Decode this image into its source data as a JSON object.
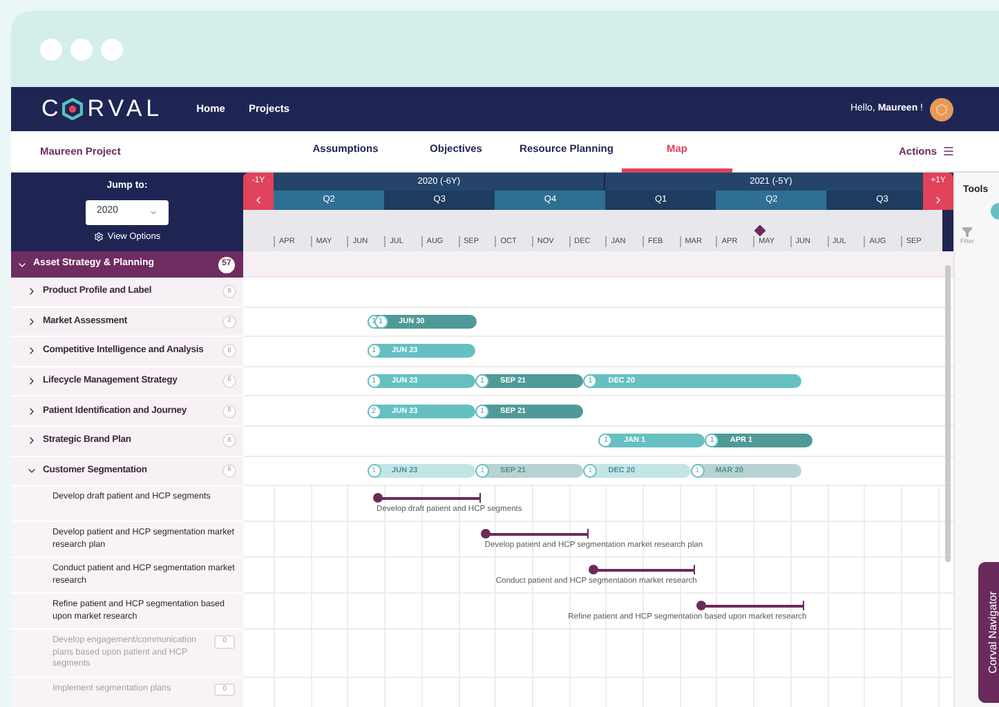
{
  "logo": {
    "left": "C",
    "right": "RVAL"
  },
  "nav": [
    "Home",
    "Projects"
  ],
  "greeting": "Hello, **Maureen** !",
  "project": "Maureen Project",
  "tabs": [
    {
      "label": "Assumptions",
      "selected": false
    },
    {
      "label": "Objectives",
      "selected": false
    },
    {
      "label": "Resource Planning",
      "selected": false
    },
    {
      "label": "Map",
      "selected": true
    }
  ],
  "actions": "Actions",
  "jump": {
    "label": "Jump to:",
    "value": "2020",
    "view_options": "View Options"
  },
  "timeline": {
    "prev_year": "-1Y",
    "next_year": "+1Y",
    "years": [
      {
        "label": "2020 (-6Y)",
        "quarters": [
          {
            "label": "Q2",
            "months": [
              "APR",
              "MAY",
              "JUN"
            ]
          },
          {
            "label": "Q3",
            "months": [
              "JUL",
              "AUG",
              "SEP"
            ]
          },
          {
            "label": "Q4",
            "months": [
              "OCT",
              "NOV",
              "DEC"
            ]
          }
        ]
      },
      {
        "label": "2021 (-5Y)",
        "quarters": [
          {
            "label": "Q1",
            "months": [
              "JAN",
              "FEB",
              "MAR"
            ]
          },
          {
            "label": "Q2",
            "months": [
              "APR",
              "MAY",
              "JUN"
            ]
          },
          {
            "label": "Q3",
            "months": [
              "JUL",
              "AUG",
              "SEP"
            ]
          }
        ]
      }
    ]
  },
  "tree": [
    {
      "kind": "group",
      "label": "Asset Strategy & Planning",
      "count": "57",
      "expanded": true,
      "children": [
        {
          "kind": "subgroup",
          "label": "Product Profile and Label",
          "count": "9",
          "expanded": false
        },
        {
          "kind": "subgroup",
          "label": "Market Assessment",
          "count": "2",
          "expanded": false,
          "segments": [
            {
              "kind": "dark",
              "badges": [
                "1",
                "1"
              ],
              "label": "JUN 30"
            }
          ]
        },
        {
          "kind": "subgroup",
          "label": "Competitive Intelligence and Analysis",
          "count": "8",
          "expanded": false,
          "segments": [
            {
              "kind": "light",
              "badges": [
                "1"
              ],
              "label": "JUN 23"
            }
          ]
        },
        {
          "kind": "subgroup",
          "label": "Lifecycle Management Strategy",
          "count": "6",
          "expanded": false,
          "segments": [
            {
              "kind": "light",
              "badges": [
                "1"
              ],
              "label": "JUN 23"
            },
            {
              "kind": "dark",
              "badges": [
                "1"
              ],
              "label": "SEP 21"
            },
            {
              "kind": "light",
              "badges": [
                "1"
              ],
              "label": "DEC 20"
            }
          ]
        },
        {
          "kind": "subgroup",
          "label": "Patient Identification and Journey",
          "count": "8",
          "expanded": false,
          "segments": [
            {
              "kind": "light",
              "badges": [
                "2"
              ],
              "label": "JUN 23"
            },
            {
              "kind": "dark",
              "badges": [
                "1"
              ],
              "label": "SEP 21"
            }
          ]
        },
        {
          "kind": "subgroup",
          "label": "Strategic Brand Plan",
          "count": "8",
          "expanded": false,
          "segments": [
            {
              "kind": "light",
              "badges": [
                "1"
              ],
              "label": "JAN 1"
            },
            {
              "kind": "dark",
              "badges": [
                "1"
              ],
              "label": "APR 1"
            }
          ]
        },
        {
          "kind": "subgroup",
          "label": "Customer Segmentation",
          "count": "6",
          "expanded": true,
          "segments": [
            {
              "kind": "light",
              "badges": [
                "1"
              ],
              "label": "JUN 23"
            },
            {
              "kind": "dark",
              "badges": [
                "1"
              ],
              "label": "SEP 21"
            },
            {
              "kind": "light",
              "badges": [
                "1"
              ],
              "label": "DEC 20"
            },
            {
              "kind": "dark",
              "badges": [
                "1"
              ],
              "label": "MAR 20"
            }
          ],
          "children": [
            {
              "kind": "task",
              "label": "Develop draft patient and HCP segments",
              "disabled": false,
              "line_label": "Develop draft patient and HCP segments"
            },
            {
              "kind": "task",
              "label": "Develop patient and HCP segmentation market research plan",
              "disabled": false,
              "line_label": "Develop patient and HCP segmentation market research plan"
            },
            {
              "kind": "task",
              "label": "Conduct patient and HCP segmentation market research",
              "disabled": false,
              "line_label": "Conduct patient and HCP segmentation market research"
            },
            {
              "kind": "task",
              "label": "Refine patient and HCP segmentation based upon market research",
              "disabled": false,
              "line_label": "Refine patient and HCP segmentation based upon market research"
            },
            {
              "kind": "task",
              "label": "Develop engagement/communication plans based upon patient and HCP segments",
              "disabled": true,
              "count": "0"
            },
            {
              "kind": "task",
              "label": "Implement segmentation plans",
              "disabled": true,
              "count": "0"
            }
          ]
        }
      ]
    }
  ],
  "tools": {
    "title": "Tools",
    "filter": "Filter",
    "navigator": "Corval Navigator"
  }
}
